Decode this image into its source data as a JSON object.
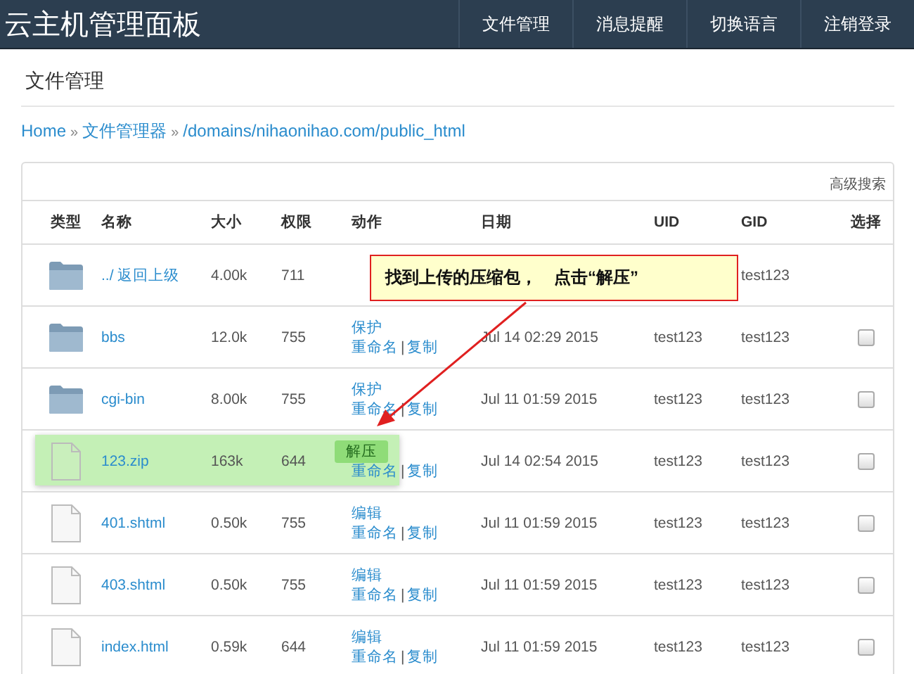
{
  "navbar": {
    "brand": "云主机管理面板",
    "items": [
      "文件管理",
      "消息提醒",
      "切换语言",
      "注销登录"
    ]
  },
  "page_title": "文件管理",
  "breadcrumb": [
    {
      "label": "Home"
    },
    {
      "label": "文件管理器"
    },
    {
      "label": "/domains/nihaonihao.com/public_html"
    }
  ],
  "separator": "»",
  "advanced_search": "高级搜索",
  "table": {
    "columns": [
      "类型",
      "名称",
      "大小",
      "权限",
      "动作",
      "日期",
      "UID",
      "GID",
      "选择"
    ],
    "rows": [
      {
        "kind": "folder",
        "name": "../ 返回上级",
        "size": "4.00k",
        "perm": "711",
        "actions": [],
        "date": "",
        "uid": "",
        "gid": "test123",
        "selectable": false,
        "checked": false,
        "highlighted": false
      },
      {
        "kind": "folder",
        "name": "bbs",
        "size": "12.0k",
        "perm": "755",
        "actions": [
          "保护",
          "重命名",
          "复制"
        ],
        "date": "Jul 14 02:29 2015",
        "uid": "test123",
        "gid": "test123",
        "selectable": true,
        "checked": false,
        "highlighted": false
      },
      {
        "kind": "folder",
        "name": "cgi-bin",
        "size": "8.00k",
        "perm": "755",
        "actions": [
          "保护",
          "重命名",
          "复制"
        ],
        "date": "Jul 11 01:59 2015",
        "uid": "test123",
        "gid": "test123",
        "selectable": true,
        "checked": false,
        "highlighted": false
      },
      {
        "kind": "file",
        "name": "123.zip",
        "size": "163k",
        "perm": "644",
        "actions": [
          "解压",
          "重命名",
          "复制"
        ],
        "date": "Jul 14 02:54 2015",
        "uid": "test123",
        "gid": "test123",
        "selectable": true,
        "checked": false,
        "highlighted": true
      },
      {
        "kind": "file",
        "name": "401.shtml",
        "size": "0.50k",
        "perm": "755",
        "actions": [
          "编辑",
          "重命名",
          "复制"
        ],
        "date": "Jul 11 01:59 2015",
        "uid": "test123",
        "gid": "test123",
        "selectable": true,
        "checked": false,
        "highlighted": false
      },
      {
        "kind": "file",
        "name": "403.shtml",
        "size": "0.50k",
        "perm": "755",
        "actions": [
          "编辑",
          "重命名",
          "复制"
        ],
        "date": "Jul 11 01:59 2015",
        "uid": "test123",
        "gid": "test123",
        "selectable": true,
        "checked": false,
        "highlighted": false
      },
      {
        "kind": "file",
        "name": "index.html",
        "size": "0.59k",
        "perm": "644",
        "actions": [
          "编辑",
          "重命名",
          "复制"
        ],
        "date": "Jul 11 01:59 2015",
        "uid": "test123",
        "gid": "test123",
        "selectable": true,
        "checked": false,
        "highlighted": false
      }
    ]
  },
  "action_separator": "|",
  "callout": {
    "text": "找到上传的压缩包，　点击“解压”"
  }
}
